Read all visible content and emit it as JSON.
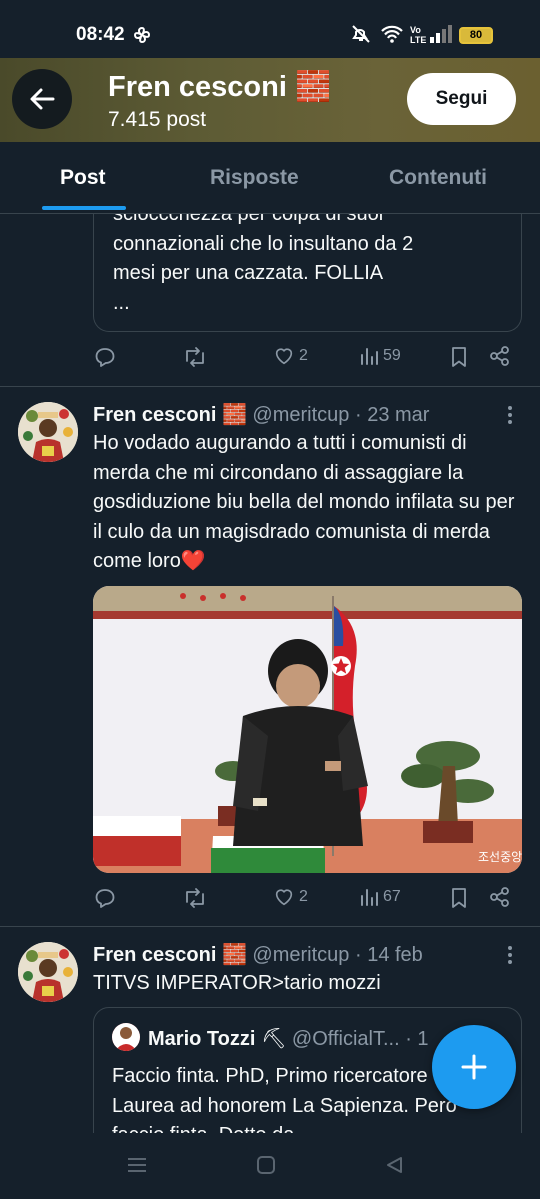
{
  "status_bar": {
    "time": "08:42",
    "battery": "80",
    "network_label": "Vo LTE"
  },
  "header": {
    "name": "Fren cesconi",
    "name_emoji": "🧱",
    "post_count": "7.415 post",
    "follow_label": "Segui"
  },
  "tabs": [
    {
      "label": "Post",
      "active": true
    },
    {
      "label": "Risposte",
      "active": false
    },
    {
      "label": "Contenuti",
      "active": false
    }
  ],
  "posts": [
    {
      "quoted_text_lines": [
        "scioccchezza per colpa di suoi",
        "connazionali che lo insultano da 2",
        "mesi per una cazzata. FOLLIA",
        "..."
      ],
      "replies": "",
      "reposts": "",
      "likes": "2",
      "views": "59"
    },
    {
      "display_name": "Fren cesconi",
      "name_emoji": "🧱",
      "handle": "@meritcup",
      "date": "· 23 mar",
      "text": "Ho vodado augurando a tutti i comunisti di merda che mi circondano di assaggiare la gosdiduzione biu bella del mondo infilata su per il culo da un magisdrado comunista di merda come loro❤️",
      "media_watermark": "조선중앙TV",
      "replies": "",
      "reposts": "",
      "likes": "2",
      "views": "67"
    },
    {
      "display_name": "Fren cesconi",
      "name_emoji": "🧱",
      "handle": "@meritcup",
      "date": "· 14 feb",
      "text": "TITVS IMPERATOR>tario mozzi",
      "quote": {
        "display_name": "Mario Tozzi",
        "name_emoji": "⛏",
        "handle": "@OfficialT...",
        "date": "· 1",
        "text": "Faccio finta. PhD, Primo ricercatore CNR, Laurea ad honorem La Sapienza. Però faccio finta. Detto da"
      }
    }
  ],
  "colors": {
    "background": "#15202b",
    "accent": "#1d9bf0",
    "muted": "#8b98a5",
    "border": "#38444d"
  }
}
